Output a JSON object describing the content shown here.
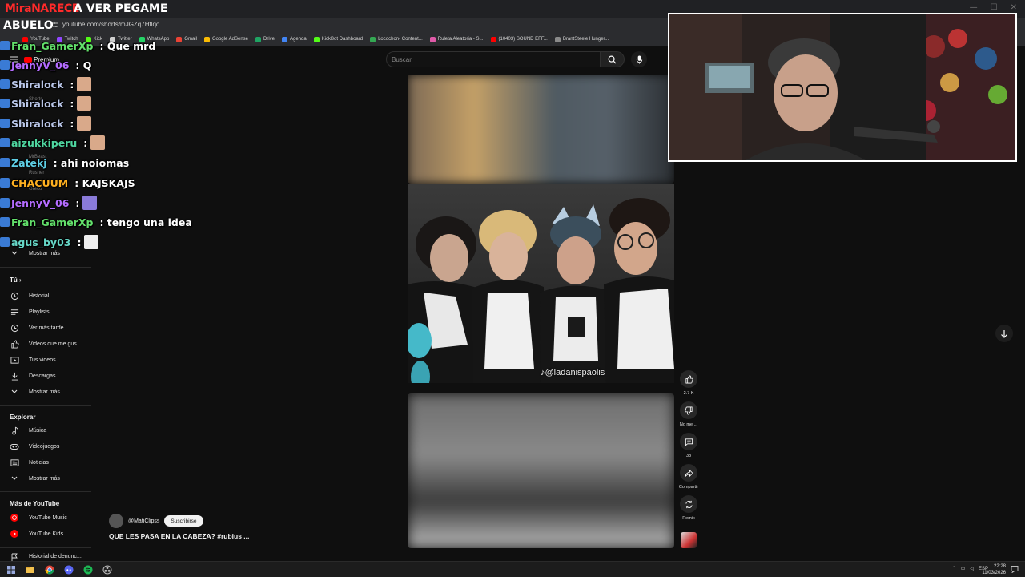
{
  "stream": {
    "overlay_tag": "MiraNARECE",
    "title_text": "A VER PEGAME",
    "channel_label": "ABUELO"
  },
  "browser": {
    "url": "youtube.com/shorts/mJGZq7Hflqo",
    "bookmarks": [
      {
        "label": "YouTube",
        "color": "#ff0000"
      },
      {
        "label": "Twitch",
        "color": "#9146ff"
      },
      {
        "label": "Kick",
        "color": "#53fc18"
      },
      {
        "label": "Twitter",
        "color": "#cfcfcf"
      },
      {
        "label": "WhatsApp",
        "color": "#25d366"
      },
      {
        "label": "Gmail",
        "color": "#ea4335"
      },
      {
        "label": "Google AdSense",
        "color": "#fbbc04"
      },
      {
        "label": "Drive",
        "color": "#1fa463"
      },
      {
        "label": "Agenda",
        "color": "#4285f4"
      },
      {
        "label": "KickBot Dashboard",
        "color": "#53fc18"
      },
      {
        "label": "Locochon- Content...",
        "color": "#34a853"
      },
      {
        "label": "Ruleta Aleatoria - S...",
        "color": "#e05aa8"
      },
      {
        "label": "(10403) SOUND EFF...",
        "color": "#ff0000"
      },
      {
        "label": "BrantSteele Hunger...",
        "color": "#8a8a8a"
      }
    ]
  },
  "youtube": {
    "search_placeholder": "Buscar",
    "logo_text": "Premium",
    "sidebar": {
      "you_header": "Tú",
      "you_items": [
        "Historial",
        "Playlists",
        "Ver más tarde",
        "Videos que me gus...",
        "Tus videos",
        "Descargas",
        "Mostrar más"
      ],
      "show_more_top": "Mostrar más",
      "explore_header": "Explorar",
      "explore_items": [
        "Música",
        "Videojuegos",
        "Noticias",
        "Mostrar más"
      ],
      "more_header": "Más de YouTube",
      "more_items": [
        "YouTube Music",
        "YouTube Kids"
      ],
      "bottom_item": "Historial de denunc...",
      "faint_items": [
        "Shorts",
        "Suscripciones",
        "MrBeast",
        "Rusher",
        "Greco"
      ]
    },
    "short": {
      "watermark": "@ladanispaolis",
      "channel": "@MatiClipss",
      "subscribe_label": "Suscribirse",
      "title": "QUE LES PASA EN LA CABEZA? #rubius ..."
    },
    "actions": {
      "likes": "2.7 K",
      "dislike": "No me ...",
      "comments": "38",
      "share": "Compartir",
      "remix": "Remix"
    }
  },
  "chat": [
    {
      "user": "Fran_GamerXp",
      "color": "#63e06b",
      "message": ": Que mrd",
      "emote": false
    },
    {
      "user": "JennyV_06",
      "color": "#b46cff",
      "message": ": Q",
      "emote": false
    },
    {
      "user": "Shiralock",
      "color": "#b9c6e8",
      "message": ":",
      "emote": true
    },
    {
      "user": "Shiralock",
      "color": "#b9c6e8",
      "message": ":",
      "emote": true
    },
    {
      "user": "Shiralock",
      "color": "#b9c6e8",
      "message": ":",
      "emote": true
    },
    {
      "user": "aizukkiperu",
      "color": "#4fd6a0",
      "message": ":",
      "emote": true
    },
    {
      "user": "Zatekj",
      "color": "#5fd0e6",
      "message": ": ahi noiomas",
      "emote": false
    },
    {
      "user": "CHACUUM",
      "color": "#ffb020",
      "message": ": KAJSKAJS",
      "emote": false
    },
    {
      "user": "JennyV_06",
      "color": "#b46cff",
      "message": ":",
      "emote": true
    },
    {
      "user": "Fran_GamerXp",
      "color": "#63e06b",
      "message": ": tengo una idea",
      "emote": false
    },
    {
      "user": "agus_by03",
      "color": "#66d6c6",
      "message": ":",
      "emote": true
    }
  ],
  "taskbar": {
    "lang": "ESP",
    "time": "22:28",
    "date": "11/03/2026"
  },
  "colors": {
    "accent": "#ff0000",
    "background": "#0f0f0f"
  }
}
